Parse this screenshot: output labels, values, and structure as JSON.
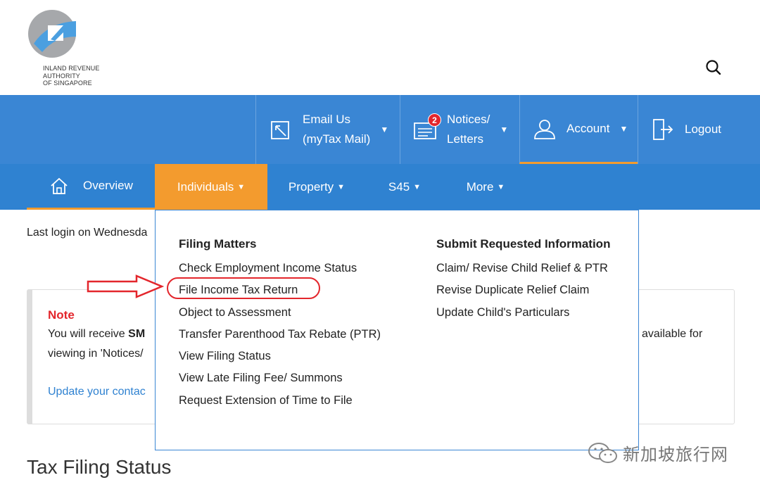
{
  "header": {
    "logo_text_lines": [
      "INLAND REVENUE",
      "AUTHORITY",
      "OF SINGAPORE"
    ],
    "search_icon": "search-icon"
  },
  "topbar": {
    "email_line1": "Email Us",
    "email_line2": "(myTax Mail)",
    "notices_line1": "Notices/",
    "notices_line2": "Letters",
    "notices_badge": "2",
    "account": "Account",
    "logout": "Logout"
  },
  "nav": {
    "overview": "Overview",
    "individuals": "Individuals",
    "property": "Property",
    "s45": "S45",
    "more": "More"
  },
  "main": {
    "last_login": "Last login on Wednesda",
    "note_title": "Note",
    "note_text1_prefix": "You will receive ",
    "note_text1_bold": "SM",
    "note_text2": "viewing in 'Notices/",
    "note_right": "available for",
    "note_link": "Update your contac",
    "page_heading": "Tax Filing Status"
  },
  "dropdown": {
    "left_heading": "Filing Matters",
    "left_items": [
      "Check Employment Income Status",
      "File Income Tax Return",
      "Object to Assessment",
      "Transfer Parenthood Tax Rebate (PTR)",
      "View Filing Status",
      "View Late Filing Fee/ Summons",
      "Request Extension of Time to File"
    ],
    "right_heading": "Submit Requested Information",
    "right_items": [
      "Claim/ Revise Child Relief & PTR",
      "Revise Duplicate Relief Claim",
      "Update Child's Particulars"
    ]
  },
  "watermark": {
    "text": "新加坡旅行网"
  },
  "colors": {
    "primary_blue": "#3a86d4",
    "nav_blue": "#2f82d1",
    "accent_orange": "#f39b2e",
    "alert_red": "#e3262c"
  }
}
